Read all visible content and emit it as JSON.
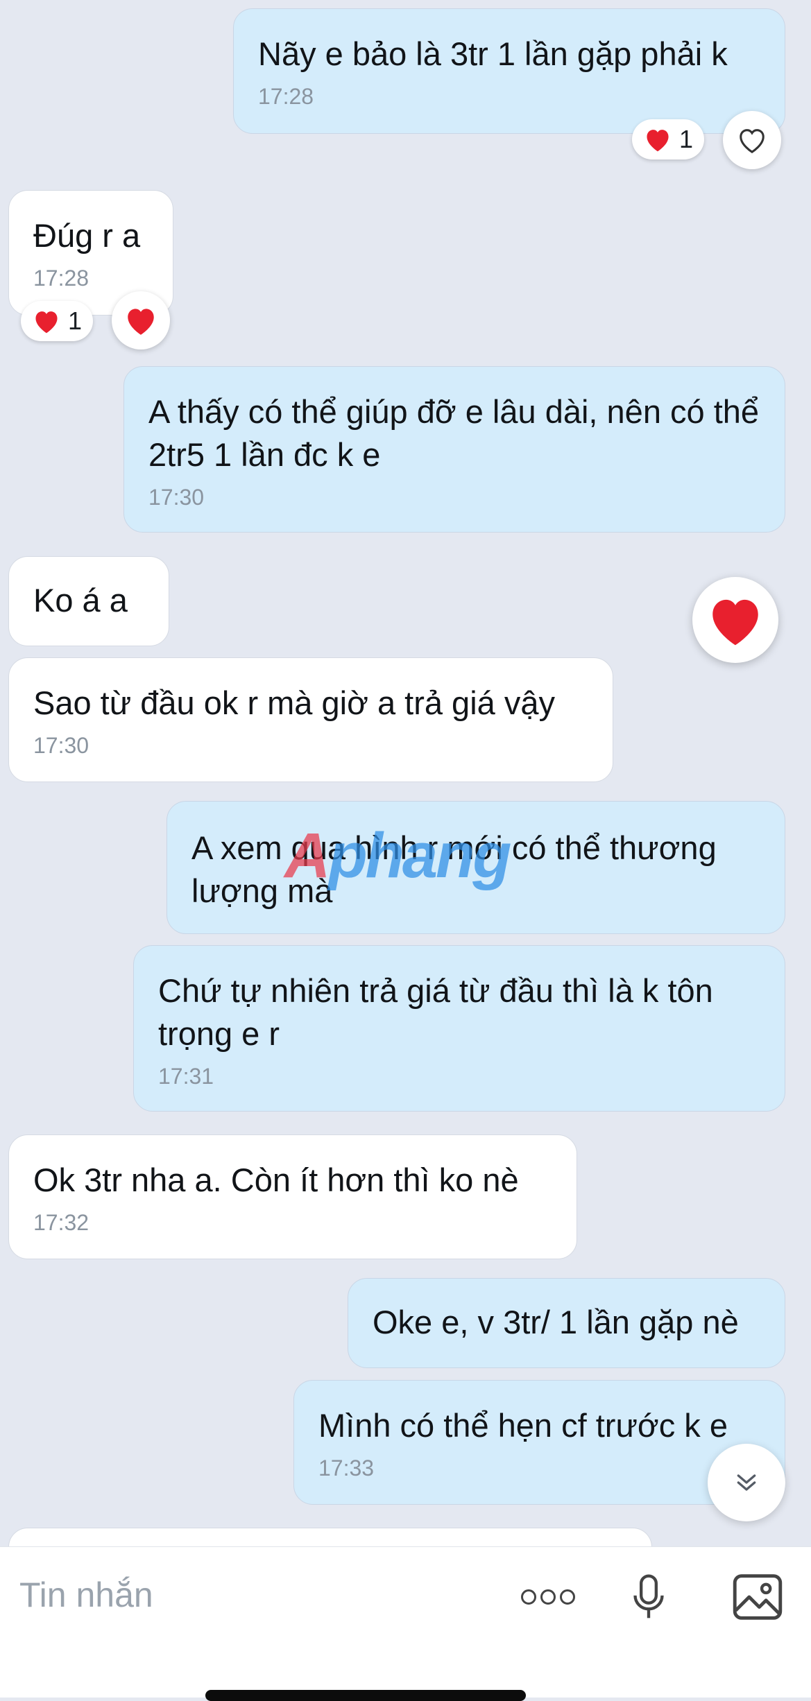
{
  "messages": [
    {
      "text": "Nãy e bảo là 3tr 1 lần gặp phải k",
      "time": "17:28"
    },
    {
      "text": "Đúg r a",
      "time": "17:28"
    },
    {
      "text": "A thấy có thể giúp đỡ e lâu dài, nên có thể 2tr5 1 lần đc k e",
      "time": "17:30"
    },
    {
      "text": "Ko á a"
    },
    {
      "text": "Sao từ đầu ok r mà giờ a trả giá vậy",
      "time": "17:30"
    },
    {
      "text": "A xem qua hình r mới có thể thương lượng mà"
    },
    {
      "text": "Chứ tự nhiên trả giá từ đầu thì là k tôn trọng e r",
      "time": "17:31"
    },
    {
      "text": "Ok 3tr nha a. Còn ít hơn thì ko nè",
      "time": "17:32"
    },
    {
      "text": "Oke e, v 3tr/ 1 lần gặp nè"
    },
    {
      "text": "Mình có thể hẹn cf trước k e",
      "time": "17:33"
    }
  ],
  "reactions": [
    {
      "count": "1"
    },
    {
      "count": "1"
    }
  ],
  "watermark": {
    "part1": "A",
    "part2": "phang"
  },
  "input": {
    "placeholder": "Tin nhắn"
  },
  "colors": {
    "outgoing_bubble": "#d4ecfb",
    "incoming_bubble": "#ffffff",
    "background": "#e4e8f1",
    "heart": "#e8202e"
  },
  "icons": [
    "heart-outline-icon",
    "heart-icon",
    "chevron-double-down-icon",
    "more-dots-icon",
    "microphone-icon",
    "image-icon"
  ]
}
